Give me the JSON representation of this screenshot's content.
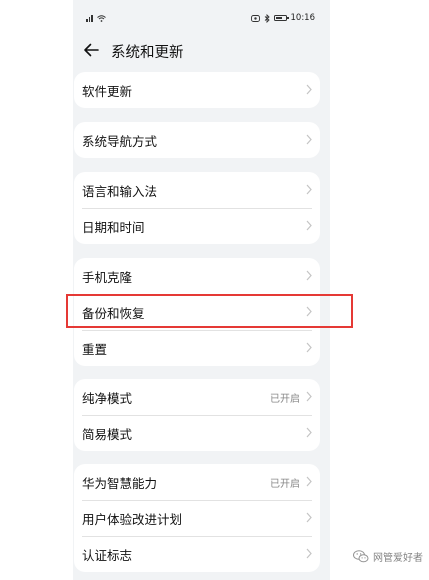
{
  "status_bar": {
    "left_indicators": "",
    "time": "10:16"
  },
  "header": {
    "title": "系统和更新",
    "back_icon": "back-arrow-icon"
  },
  "groups": [
    {
      "items": [
        {
          "label": "软件更新",
          "value": ""
        }
      ]
    },
    {
      "items": [
        {
          "label": "系统导航方式",
          "value": ""
        }
      ]
    },
    {
      "items": [
        {
          "label": "语言和输入法",
          "value": ""
        },
        {
          "label": "日期和时间",
          "value": ""
        }
      ]
    },
    {
      "items": [
        {
          "label": "手机克隆",
          "value": ""
        },
        {
          "label": "备份和恢复",
          "value": ""
        },
        {
          "label": "重置",
          "value": ""
        }
      ]
    },
    {
      "items": [
        {
          "label": "纯净模式",
          "value": "已开启"
        },
        {
          "label": "简易模式",
          "value": ""
        }
      ]
    },
    {
      "items": [
        {
          "label": "华为智慧能力",
          "value": "已开启"
        },
        {
          "label": "用户体验改进计划",
          "value": ""
        },
        {
          "label": "认证标志",
          "value": ""
        }
      ]
    }
  ],
  "highlight": {
    "target": "备份和恢复",
    "color": "#e53935"
  },
  "watermark": {
    "text": "网管爱好者",
    "icon": "wechat-icon"
  },
  "colors": {
    "background": "#f1f3f5",
    "card": "#ffffff",
    "text": "#111111",
    "secondary_text": "#888888",
    "chevron": "#c4c4c4"
  }
}
